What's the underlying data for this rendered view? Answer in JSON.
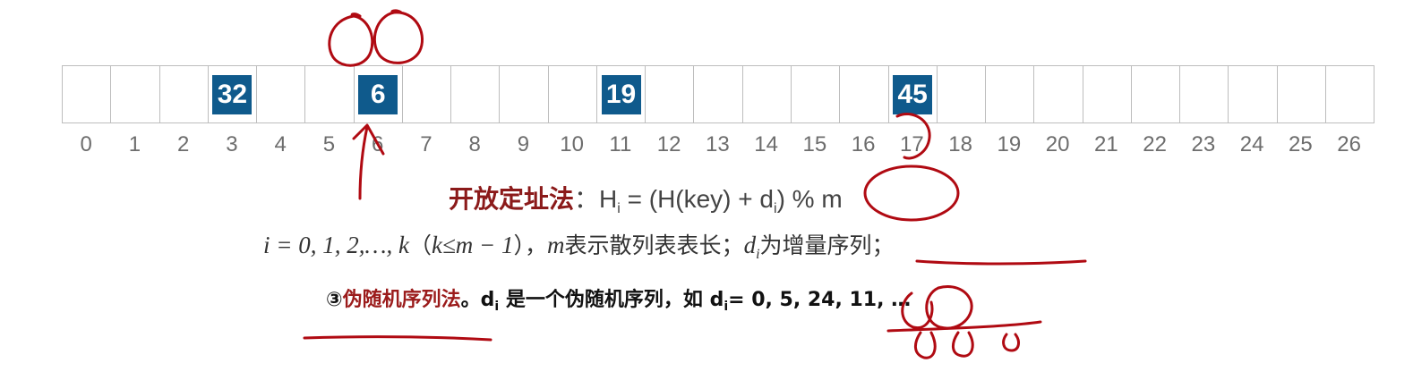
{
  "hash_table": {
    "indices": [
      "0",
      "1",
      "2",
      "3",
      "4",
      "5",
      "6",
      "7",
      "8",
      "9",
      "10",
      "11",
      "12",
      "13",
      "14",
      "15",
      "16",
      "17",
      "18",
      "19",
      "20",
      "21",
      "22",
      "23",
      "24",
      "25",
      "26"
    ],
    "slots": [
      "",
      "",
      "",
      "32",
      "",
      "",
      "6",
      "",
      "",
      "",
      "",
      "19",
      "",
      "",
      "",
      "",
      "",
      "45",
      "",
      "",
      "",
      "",
      "",
      "",
      "",
      "",
      ""
    ],
    "filled_color": "#0f5a8c"
  },
  "formula_line": {
    "method_name": "开放定址法",
    "colon": "：",
    "expr_h": "H",
    "expr_h_sub": "i",
    "expr_mid": " = (H(key) + d",
    "expr_d_sub": "i",
    "expr_end": ") % m"
  },
  "params_line": {
    "i_range": "i = 0, 1, 2,…, k",
    "paren_open": "（",
    "k_cond": "k≤m − 1",
    "paren_close": "）",
    "comma": "，",
    "m_var": "m",
    "m_desc": "表示散列表表长；",
    "d_var": "d",
    "d_sub": "i",
    "d_desc": "为增量序列；"
  },
  "method3_line": {
    "prefix": "③",
    "name": "伪随机序列法",
    "period": "。",
    "d_var": "d",
    "d_sub": "i",
    "desc": " 是一个伪随机序列，如 ",
    "d_var2": "d",
    "d_sub2": "i",
    "seq": "= 0, 5, 24, 11, …"
  },
  "colors": {
    "method_red": "#8b1a1a",
    "annotation_red": "#b00a12",
    "index_gray": "#6d6d6d"
  }
}
